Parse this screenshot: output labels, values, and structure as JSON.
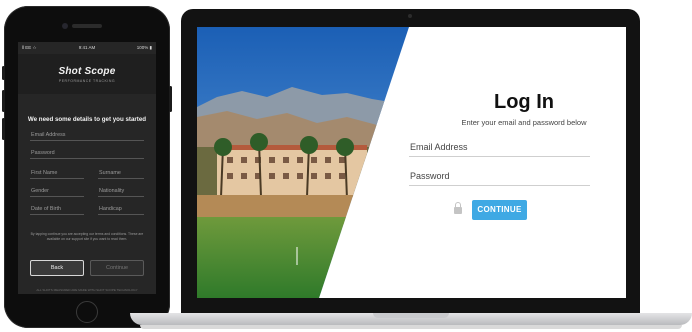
{
  "phone": {
    "status": {
      "carrier": "ll EE ☆",
      "time": "9:41 AM",
      "battery": "100% ▮"
    },
    "logo": {
      "name": "Shot Scope",
      "tagline": "PERFORMANCE TRACKING"
    },
    "heading": "We need some details to get you started",
    "fields": {
      "email": "Email Address",
      "password": "Password",
      "first_name": "First Name",
      "surname": "Surname",
      "gender": "Gender",
      "nationality": "Nationality",
      "dob": "Date of Birth",
      "handicap": "Handicap"
    },
    "terms": "By tapping continue you are accepting our terms and conditions. These are available on our support site if you want to read them.",
    "back_label": "Back",
    "continue_label": "Continue",
    "footer": "ALL SHOTS MEASURED ARE MADE WITH SHOT SCOPE TECHNOLOGY"
  },
  "laptop": {
    "title": "Log In",
    "subtitle": "Enter your email and password below",
    "email_placeholder": "Email Address",
    "password_placeholder": "Password",
    "continue_label": "CONTINUE"
  },
  "colors": {
    "accent": "#3fa9e4",
    "phone_bg": "#262626"
  },
  "icons": [
    "lock-icon"
  ]
}
